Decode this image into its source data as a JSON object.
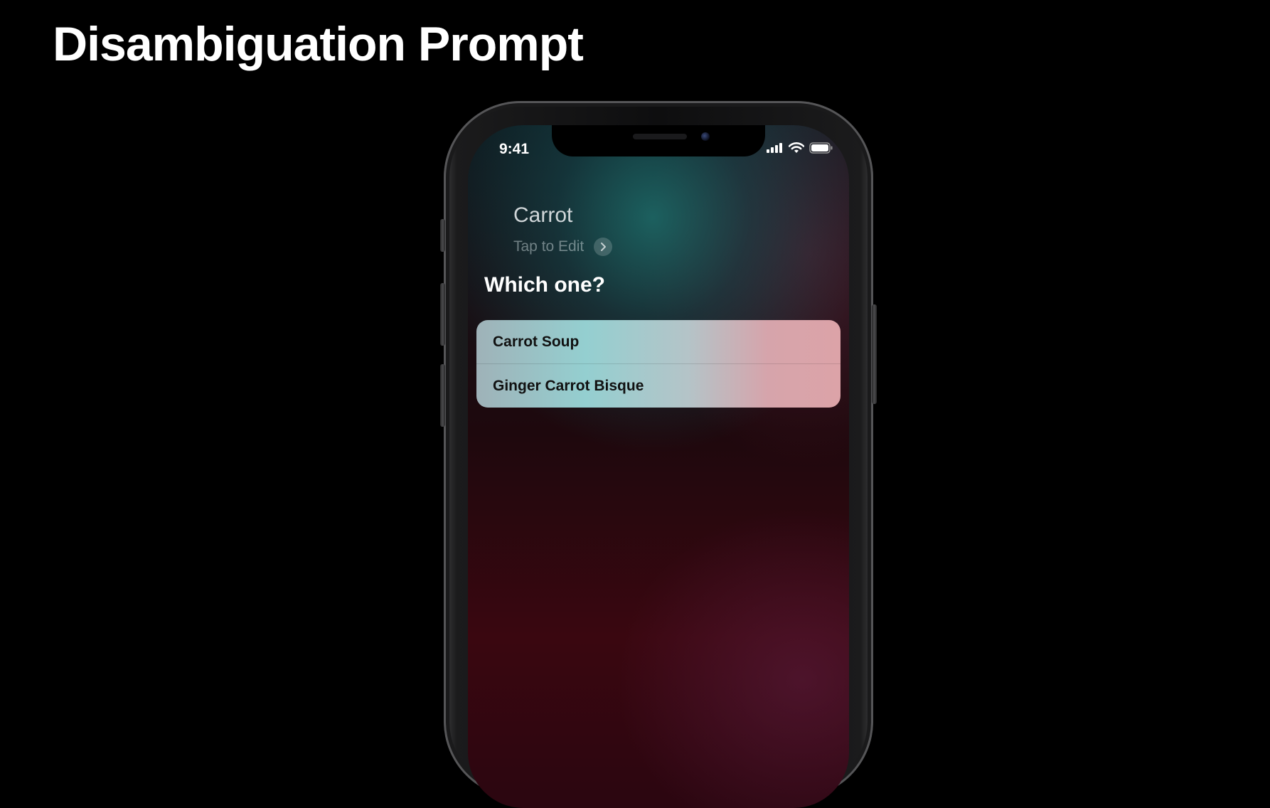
{
  "slide": {
    "title": "Disambiguation Prompt"
  },
  "status_bar": {
    "time": "9:41",
    "icons": [
      "cellular-signal-icon",
      "wifi-icon",
      "battery-icon"
    ]
  },
  "siri": {
    "query": "Carrot",
    "tap_to_edit": "Tap to Edit",
    "prompt": "Which one?",
    "options": [
      {
        "label": "Carrot Soup"
      },
      {
        "label": "Ginger Carrot Bisque"
      }
    ]
  },
  "colors": {
    "background": "#000000",
    "title_text": "#ffffff",
    "options_teal": "#94cfd0",
    "options_pink": "#dca3a8"
  }
}
